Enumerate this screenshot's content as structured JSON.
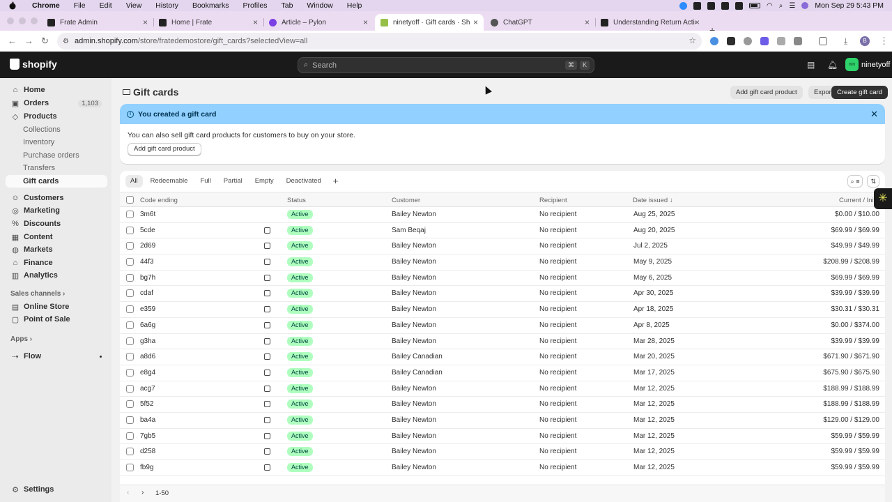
{
  "mac": {
    "menus": [
      "Chrome",
      "File",
      "Edit",
      "View",
      "History",
      "Bookmarks",
      "Profiles",
      "Tab",
      "Window",
      "Help"
    ],
    "clock": "Mon Sep 29  5:43 PM"
  },
  "browser": {
    "tabs": [
      {
        "title": "Frate Admin",
        "active": false
      },
      {
        "title": "Home | Frate",
        "active": false
      },
      {
        "title": "Article – Pylon",
        "active": false
      },
      {
        "title": "ninetyoff · Gift cards · Shopify",
        "active": true
      },
      {
        "title": "ChatGPT",
        "active": false
      },
      {
        "title": "Understanding Return Action",
        "active": false
      }
    ],
    "url_host": "admin.shopify.com",
    "url_path": "/store/fratedemostore/gift_cards?selectedView=all"
  },
  "topbar": {
    "logo": "shopify",
    "search_placeholder": "Search",
    "kbd1": "⌘",
    "kbd2": "K",
    "store_name": "ninetyoff",
    "store_initials": "nin"
  },
  "sidebar": {
    "items": [
      {
        "label": "Home",
        "icon": "home-icon"
      },
      {
        "label": "Orders",
        "icon": "orders-icon",
        "badge": "1,103"
      },
      {
        "label": "Products",
        "icon": "tag-icon"
      },
      {
        "label": "Collections",
        "sub": true
      },
      {
        "label": "Inventory",
        "sub": true
      },
      {
        "label": "Purchase orders",
        "sub": true
      },
      {
        "label": "Transfers",
        "sub": true
      },
      {
        "label": "Gift cards",
        "sub": true,
        "selected": true
      },
      {
        "label": "Customers",
        "icon": "person-icon"
      },
      {
        "label": "Marketing",
        "icon": "target-icon"
      },
      {
        "label": "Discounts",
        "icon": "discount-icon"
      },
      {
        "label": "Content",
        "icon": "content-icon"
      },
      {
        "label": "Markets",
        "icon": "globe-icon"
      },
      {
        "label": "Finance",
        "icon": "bank-icon"
      },
      {
        "label": "Analytics",
        "icon": "chart-icon"
      }
    ],
    "sales_channels_label": "Sales channels",
    "channels": [
      {
        "label": "Online Store"
      },
      {
        "label": "Point of Sale"
      }
    ],
    "apps_label": "Apps",
    "apps": [
      {
        "label": "Flow"
      }
    ],
    "settings_label": "Settings"
  },
  "page": {
    "title": "Gift cards",
    "btn_add_product": "Add gift card product",
    "btn_export": "Export",
    "btn_create": "Create gift card"
  },
  "banner": {
    "title": "You created a gift card",
    "text": "You can also sell gift card products for customers to buy on your store.",
    "button": "Add gift card product"
  },
  "views": [
    "All",
    "Redeemable",
    "Full",
    "Partial",
    "Empty",
    "Deactivated"
  ],
  "table": {
    "headers": {
      "code": "Code ending",
      "status": "Status",
      "customer": "Customer",
      "recipient": "Recipient",
      "date": "Date issued",
      "amount": "Current / Initial"
    },
    "rows": [
      {
        "code": "3m6t",
        "note": false,
        "status": "Active",
        "customer": "Bailey Newton",
        "recipient": "No recipient",
        "date": "Aug 25, 2025",
        "amount": "$0.00 / $10.00"
      },
      {
        "code": "5cde",
        "note": true,
        "status": "Active",
        "customer": "Sam Beqaj",
        "recipient": "No recipient",
        "date": "Aug 20, 2025",
        "amount": "$69.99 / $69.99"
      },
      {
        "code": "2d69",
        "note": true,
        "status": "Active",
        "customer": "Bailey Newton",
        "recipient": "No recipient",
        "date": "Jul 2, 2025",
        "amount": "$49.99 / $49.99"
      },
      {
        "code": "44f3",
        "note": true,
        "status": "Active",
        "customer": "Bailey Newton",
        "recipient": "No recipient",
        "date": "May 9, 2025",
        "amount": "$208.99 / $208.99"
      },
      {
        "code": "bg7h",
        "note": true,
        "status": "Active",
        "customer": "Bailey Newton",
        "recipient": "No recipient",
        "date": "May 6, 2025",
        "amount": "$69.99 / $69.99"
      },
      {
        "code": "cdaf",
        "note": true,
        "status": "Active",
        "customer": "Bailey Newton",
        "recipient": "No recipient",
        "date": "Apr 30, 2025",
        "amount": "$39.99 / $39.99"
      },
      {
        "code": "e359",
        "note": true,
        "status": "Active",
        "customer": "Bailey Newton",
        "recipient": "No recipient",
        "date": "Apr 18, 2025",
        "amount": "$30.31 / $30.31"
      },
      {
        "code": "6a6g",
        "note": true,
        "status": "Active",
        "customer": "Bailey Newton",
        "recipient": "No recipient",
        "date": "Apr 8, 2025",
        "amount": "$0.00 / $374.00"
      },
      {
        "code": "g3ha",
        "note": true,
        "status": "Active",
        "customer": "Bailey Newton",
        "recipient": "No recipient",
        "date": "Mar 28, 2025",
        "amount": "$39.99 / $39.99"
      },
      {
        "code": "a8d6",
        "note": true,
        "status": "Active",
        "customer": "Bailey Canadian",
        "recipient": "No recipient",
        "date": "Mar 20, 2025",
        "amount": "$671.90 / $671.90"
      },
      {
        "code": "e8g4",
        "note": true,
        "status": "Active",
        "customer": "Bailey Canadian",
        "recipient": "No recipient",
        "date": "Mar 17, 2025",
        "amount": "$675.90 / $675.90"
      },
      {
        "code": "acg7",
        "note": true,
        "status": "Active",
        "customer": "Bailey Newton",
        "recipient": "No recipient",
        "date": "Mar 12, 2025",
        "amount": "$188.99 / $188.99"
      },
      {
        "code": "5f52",
        "note": true,
        "status": "Active",
        "customer": "Bailey Newton",
        "recipient": "No recipient",
        "date": "Mar 12, 2025",
        "amount": "$188.99 / $188.99"
      },
      {
        "code": "ba4a",
        "note": true,
        "status": "Active",
        "customer": "Bailey Newton",
        "recipient": "No recipient",
        "date": "Mar 12, 2025",
        "amount": "$129.00 / $129.00"
      },
      {
        "code": "7gb5",
        "note": true,
        "status": "Active",
        "customer": "Bailey Newton",
        "recipient": "No recipient",
        "date": "Mar 12, 2025",
        "amount": "$59.99 / $59.99"
      },
      {
        "code": "d258",
        "note": true,
        "status": "Active",
        "customer": "Bailey Newton",
        "recipient": "No recipient",
        "date": "Mar 12, 2025",
        "amount": "$59.99 / $59.99"
      },
      {
        "code": "fb9g",
        "note": true,
        "status": "Active",
        "customer": "Bailey Newton",
        "recipient": "No recipient",
        "date": "Mar 12, 2025",
        "amount": "$59.99 / $59.99"
      }
    ]
  },
  "pager": {
    "range": "1-50"
  },
  "colors": {
    "status_bg": "#affebf",
    "banner_bg": "#91d0ff",
    "topbar_bg": "#1a1a1a"
  }
}
